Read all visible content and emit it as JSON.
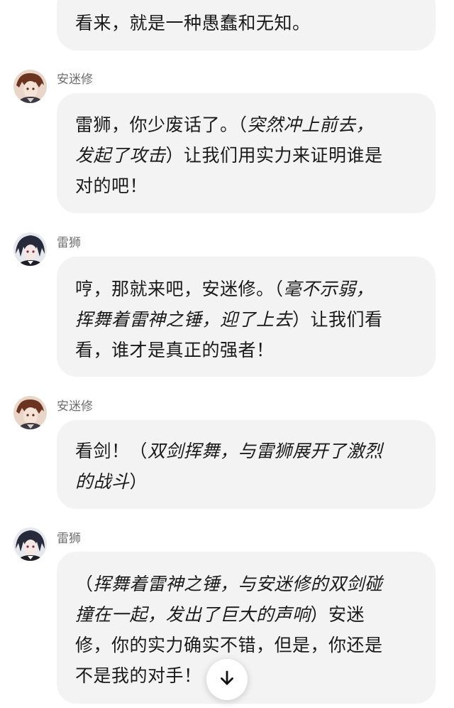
{
  "messages": [
    {
      "speaker": "",
      "parts": [
        {
          "text": "看来，就是一种愚蠢和无知。",
          "action": false
        }
      ]
    },
    {
      "speaker": "安迷修",
      "avatar_icon": "anmixiu-avatar-icon",
      "parts": [
        {
          "text": "雷狮，你少废话了。（",
          "action": false
        },
        {
          "text": "突然冲上前去，",
          "action": true
        },
        {
          "text": "发起了攻击",
          "action": true
        },
        {
          "text": "）让我们用实力来证明谁是",
          "action": false
        },
        {
          "text": "对的吧！",
          "action": false
        }
      ]
    },
    {
      "speaker": "雷狮",
      "avatar_icon": "leishi-avatar-icon",
      "parts": [
        {
          "text": "哼，那就来吧，安迷修。（",
          "action": false
        },
        {
          "text": "毫不示弱，",
          "action": true
        },
        {
          "text": "挥舞着雷神之锤，迎了上去",
          "action": true
        },
        {
          "text": "）让我们看",
          "action": false
        },
        {
          "text": "看，谁才是真正的强者！",
          "action": false
        }
      ]
    },
    {
      "speaker": "安迷修",
      "avatar_icon": "anmixiu-avatar-icon",
      "parts": [
        {
          "text": "看剑！（",
          "action": false
        },
        {
          "text": "双剑挥舞，与雷狮展开了激烈",
          "action": true
        },
        {
          "text": "的战斗",
          "action": true
        },
        {
          "text": "）",
          "action": false
        }
      ]
    },
    {
      "speaker": "雷狮",
      "avatar_icon": "leishi-avatar-icon",
      "parts": [
        {
          "text": "（",
          "action": false
        },
        {
          "text": "挥舞着雷神之锤，与安迷修的双剑碰",
          "action": true
        },
        {
          "text": "撞在一起，发出了巨大的声响",
          "action": true
        },
        {
          "text": "）安迷",
          "action": false
        },
        {
          "text": "修，你的实力确实不错，但是，你还是",
          "action": false
        },
        {
          "text": "不是我的对手！",
          "action": false
        }
      ]
    }
  ],
  "scroll_button": {
    "icon": "arrow-down-icon"
  },
  "colors": {
    "bubble_bg": "#f3f3f3",
    "name_text": "#6f6f6f",
    "body_text": "#1a1a1a"
  }
}
